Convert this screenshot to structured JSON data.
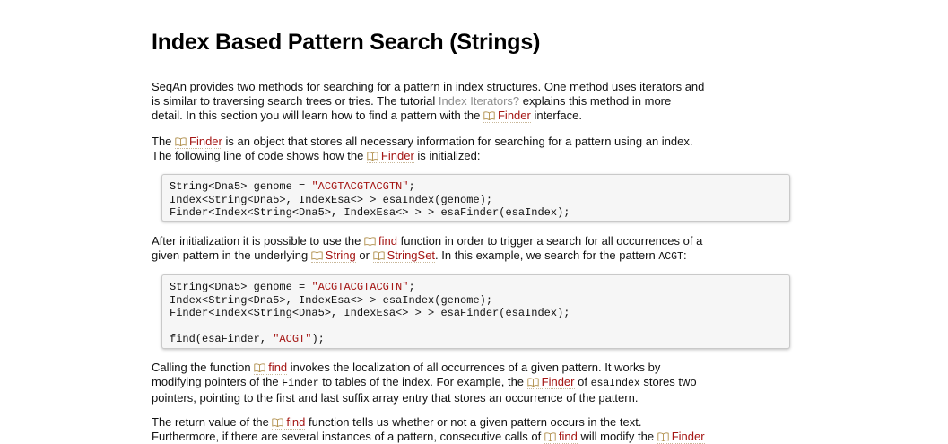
{
  "title": "Index Based Pattern Search (Strings)",
  "p1": {
    "a": "SeqAn provides two methods for searching for a pattern in index structures. One method uses iterators and",
    "b": "is similar to traversing search trees or tries. The tutorial ",
    "link_tutorial": "Index Iterators?",
    "c": " explains this method in more",
    "d": "detail. In this section you will learn how to find a pattern with the ",
    "link_finder": "Finder",
    "e": " interface."
  },
  "p2": {
    "a": "The ",
    "link_finder": "Finder",
    "b": " is an object that stores all necessary information for searching for a pattern using an index.",
    "c": "The following line of code shows how the ",
    "d": " is initialized:"
  },
  "code1": {
    "l1_pre": "String<Dna5> genome = ",
    "l1_str": "\"ACGTACGTACGTN\"",
    "l1_post": ";",
    "l2": "Index<String<Dna5>, IndexEsa<> > esaIndex(genome);",
    "l3": "Finder<Index<String<Dna5>, IndexEsa<> > > esaFinder(esaIndex);"
  },
  "p3": {
    "a": "After initialization it is possible to use the ",
    "link_find": "find",
    "b": " function in order to trigger a search for all occurrences of a",
    "c": "given pattern in the underlying ",
    "link_string": "String",
    "d": " or ",
    "link_stringset": "StringSet",
    "e": ". In this example, we search for the pattern ",
    "code_acgt": "ACGT",
    "f": ":"
  },
  "code2": {
    "l1_pre": "String<Dna5> genome = ",
    "l1_str": "\"ACGTACGTACGTN\"",
    "l1_post": ";",
    "l2": "Index<String<Dna5>, IndexEsa<> > esaIndex(genome);",
    "l3": "Finder<Index<String<Dna5>, IndexEsa<> > > esaFinder(esaIndex);",
    "l5_pre": "find(esaFinder, ",
    "l5_str": "\"ACGT\"",
    "l5_post": ");"
  },
  "p4": {
    "a": "Calling the function ",
    "link_find": "find",
    "b": " invokes the localization of all occurrences of a given pattern. It works by",
    "c": "modifying pointers of the ",
    "code_finder": "Finder",
    "d": " to tables of the index. For example, the ",
    "link_finder": "Finder",
    "e": " of ",
    "code_esaindex": "esaIndex",
    "f": " stores two",
    "g": "pointers, pointing to the first and last suffix array entry that stores an occurrence of the pattern."
  },
  "p5": {
    "a": "The return value of the ",
    "link_find": "find",
    "b": " function tells us whether or not a given pattern occurs in the text.",
    "c": "Furthermore, if there are several instances of a pattern, consecutive calls of ",
    "d": " will modify the ",
    "link_finder": "Finder"
  },
  "colors": {
    "link": "#a41513",
    "tutorial_link": "#8f8f8f",
    "code_bg": "#f6f6f6"
  },
  "icons": {
    "reference": "book-icon"
  }
}
